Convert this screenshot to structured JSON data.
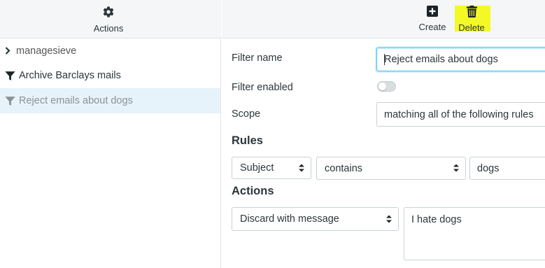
{
  "left_toolbar": {
    "actions_label": "Actions",
    "actions_icon": "gear-icon"
  },
  "tree": {
    "group_label": "managesieve",
    "filters": [
      {
        "label": "Archive Barclays mails",
        "icon": "filter-icon",
        "selected": false
      },
      {
        "label": "Reject emails about dogs",
        "icon": "filter-icon",
        "selected": true
      }
    ]
  },
  "right_toolbar": {
    "create_label": "Create",
    "create_icon": "plus-square-icon",
    "delete_label": "Delete",
    "delete_icon": "trash-icon",
    "highlight_color": "#f4f925"
  },
  "form": {
    "filter_name_label": "Filter name",
    "filter_name_value": "Reject emails about dogs",
    "filter_enabled_label": "Filter enabled",
    "filter_enabled": false,
    "scope_label": "Scope",
    "scope_value": "matching all of the following rules",
    "rules_heading": "Rules",
    "rule": {
      "header": "Subject",
      "operator": "contains",
      "value": "dogs"
    },
    "actions_heading": "Actions",
    "action": {
      "type": "Discard with message",
      "message": "I hate dogs"
    }
  },
  "colors": {
    "selected_row_bg": "#e6f3fa",
    "focus_border": "#37beff",
    "toolbar_bg": "#f4f6f7"
  }
}
